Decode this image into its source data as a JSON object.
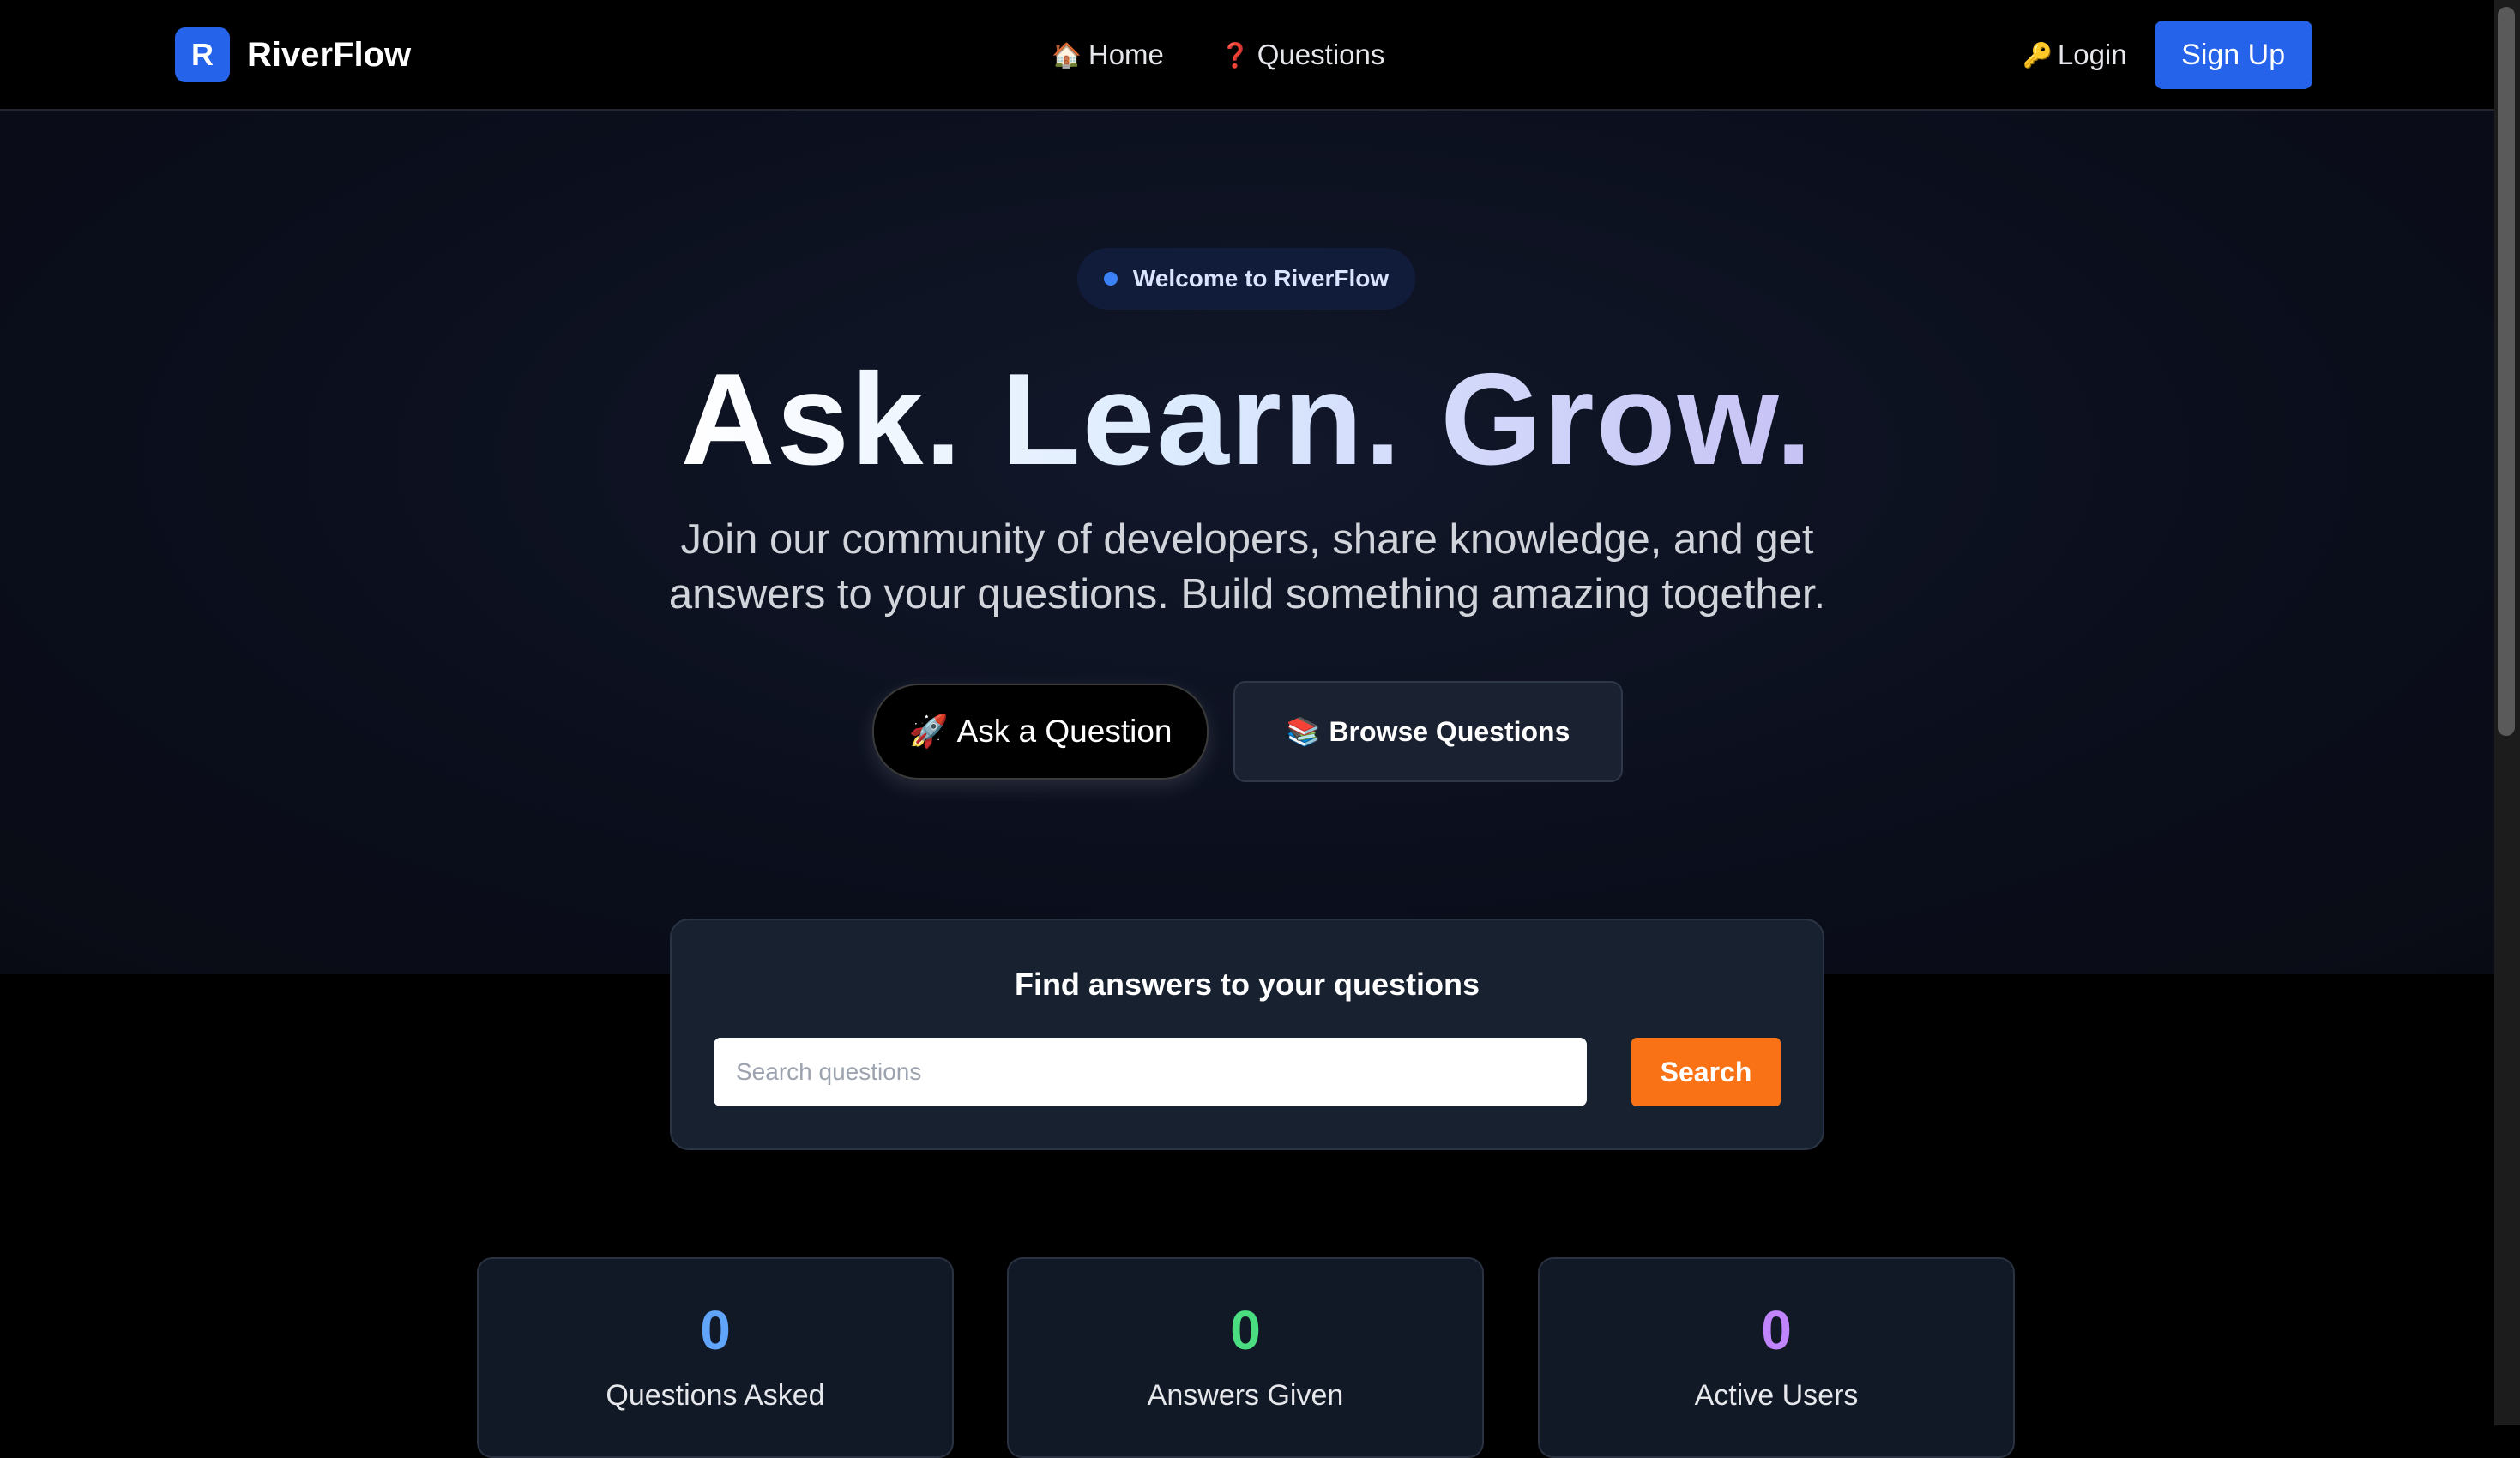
{
  "nav": {
    "logo_letter": "R",
    "brand": "RiverFlow",
    "links": [
      {
        "icon": "🏠",
        "label": "Home"
      },
      {
        "icon": "❓",
        "label": "Questions"
      }
    ],
    "login": {
      "icon": "🔑",
      "label": "Login"
    },
    "signup_label": "Sign Up"
  },
  "hero": {
    "badge": "Welcome to RiverFlow",
    "headline": "Ask. Learn. Grow.",
    "subtext": "Join our community of developers, share knowledge, and get answers to your questions. Build something amazing together.",
    "ask_button": {
      "icon": "🚀",
      "label": "Ask a Question"
    },
    "browse_button": {
      "icon": "📚",
      "label": "Browse Questions"
    }
  },
  "search": {
    "title": "Find answers to your questions",
    "placeholder": "Search questions",
    "value": "",
    "button_label": "Search"
  },
  "stats": [
    {
      "value": "0",
      "label": "Questions Asked",
      "color": "#60a5fa"
    },
    {
      "value": "0",
      "label": "Answers Given",
      "color": "#4ade80"
    },
    {
      "value": "0",
      "label": "Active Users",
      "color": "#c084fc"
    }
  ],
  "colors": {
    "accent": "#2563eb",
    "search_button": "#f97316",
    "background": "#000000"
  }
}
